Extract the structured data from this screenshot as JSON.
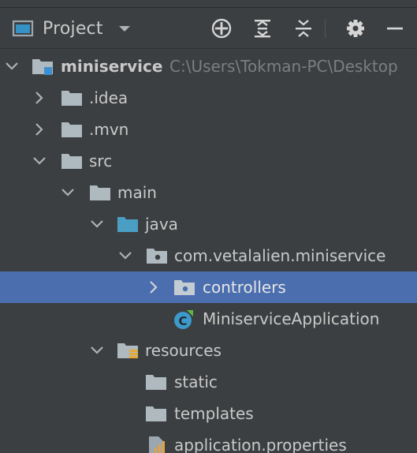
{
  "toolbar": {
    "title": "Project",
    "icons": [
      "project-view-icon",
      "dropdown-arrow-icon",
      "locate-icon",
      "expand-all-icon",
      "collapse-all-icon",
      "settings-gear-icon",
      "hide-minus-icon"
    ]
  },
  "tree": {
    "root": {
      "name": "miniservice",
      "path": "C:\\Users\\Tokman-PC\\Desktop"
    },
    "items": [
      {
        "name": ".idea"
      },
      {
        "name": ".mvn"
      },
      {
        "name": "src"
      },
      {
        "name": "main"
      },
      {
        "name": "java"
      },
      {
        "name": "com.vetalalien.miniservice"
      },
      {
        "name": "controllers"
      },
      {
        "name": "MiniserviceApplication"
      },
      {
        "name": "resources"
      },
      {
        "name": "static"
      },
      {
        "name": "templates"
      },
      {
        "name": "application.properties"
      }
    ]
  },
  "colors": {
    "background": "#3c3f41",
    "selection": "#4b6eaf",
    "text": "#c9c9c9",
    "path_text": "#7b7f82",
    "folder": "#aeb9c0",
    "source_folder": "#4a9ec4",
    "spring_icon": "#3d9acb"
  }
}
